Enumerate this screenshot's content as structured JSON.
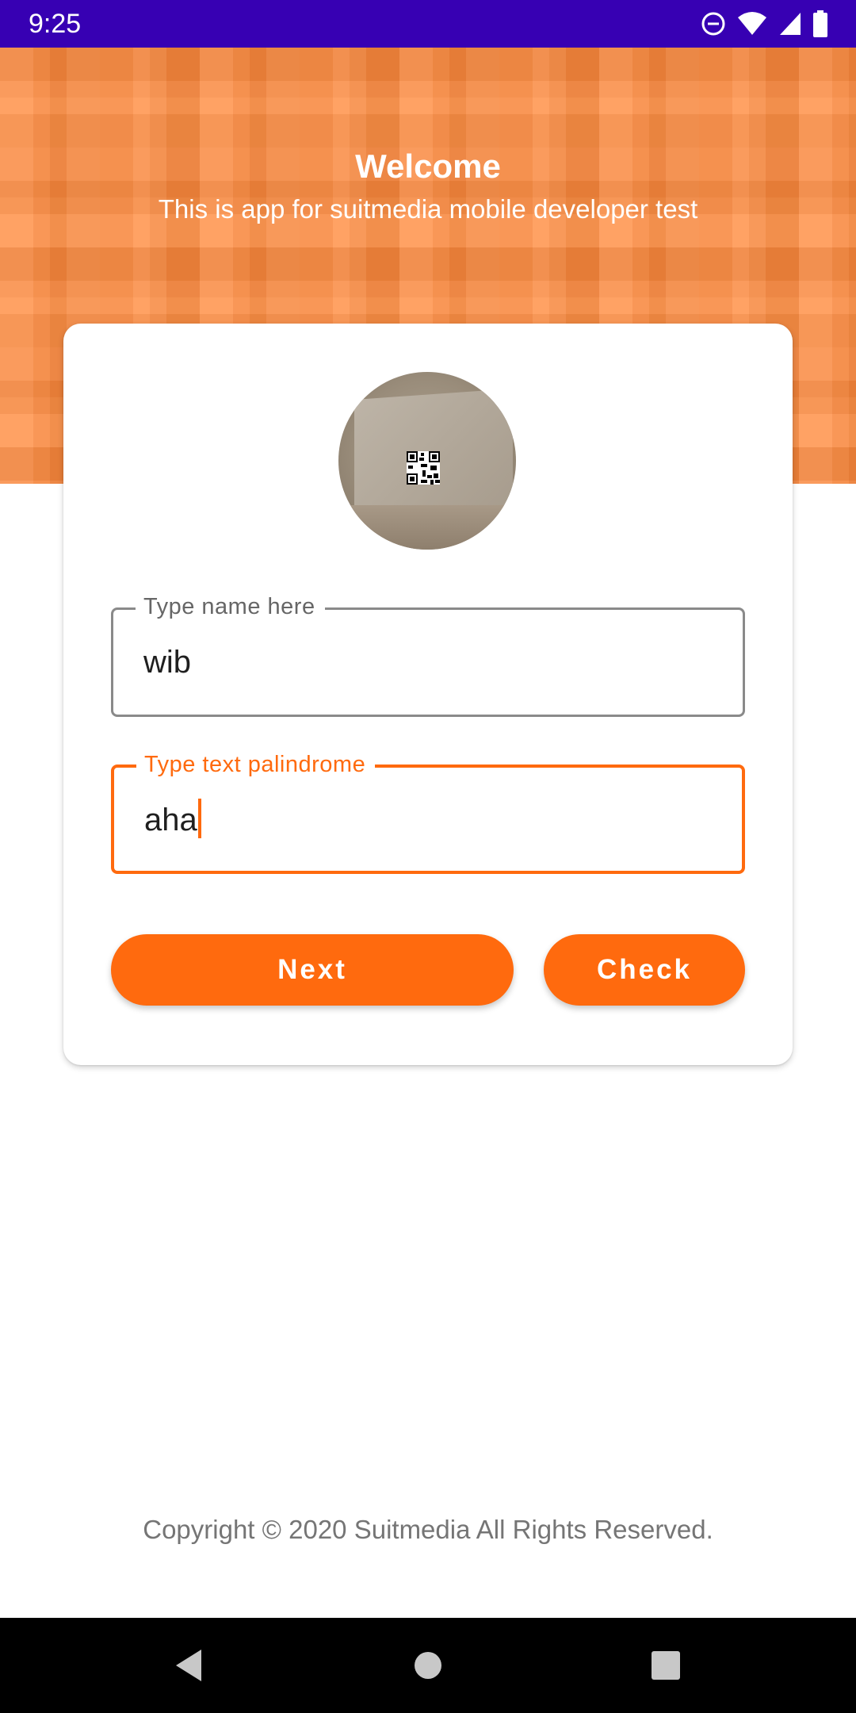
{
  "status_bar": {
    "time": "9:25",
    "icons": [
      "do-not-disturb-icon",
      "wifi-icon",
      "signal-icon",
      "battery-icon"
    ]
  },
  "header": {
    "title": "Welcome",
    "subtitle": "This is app for suitmedia mobile developer test"
  },
  "form": {
    "avatar_icon": "profile-photo-qr-icon",
    "name_field": {
      "label": "Type name here",
      "value": "wib"
    },
    "palindrome_field": {
      "label": "Type text palindrome",
      "value": "aha",
      "focused": true
    },
    "next_label": "Next",
    "check_label": "Check"
  },
  "footer": {
    "copyright": "Copyright © 2020 Suitmedia All Rights Reserved."
  },
  "nav_bar": {
    "icons": [
      "back-icon",
      "home-icon",
      "recents-icon"
    ]
  },
  "colors": {
    "status_bar": "#3700b3",
    "header": "#ff8a3d",
    "accent": "#ff6a0e",
    "nav_bar": "#000000"
  }
}
